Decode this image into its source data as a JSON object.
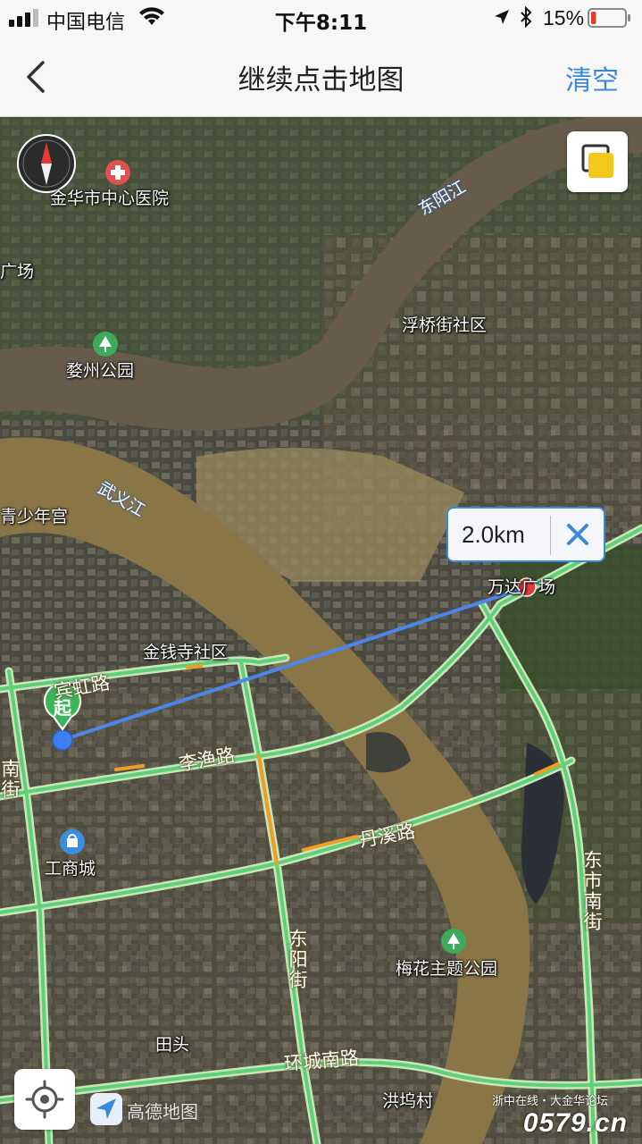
{
  "status_bar": {
    "carrier": "中国电信",
    "time": "下午8:11",
    "battery_percent": "15%",
    "battery_level": 0.15
  },
  "nav": {
    "title": "继续点击地图",
    "clear_label": "清空"
  },
  "map": {
    "distance": {
      "label": "2.0km"
    },
    "start_marker_label": "起",
    "pois": {
      "hospital": "金华市中心医院",
      "square_left": "广场",
      "fuqiao": "浮桥街社区",
      "lizhou_park": "婺州公园",
      "youth_palace": "青少年宫",
      "wanda": "万达广场",
      "jinqiansi": "金钱寺社区",
      "gongshang": "工商城",
      "meihua_park": "梅花主题公园",
      "tiantou": "田头",
      "hongwu": "洪坞村"
    },
    "rivers": {
      "dongyang_river": "东阳江",
      "wuyi_river": "武义江"
    },
    "roads": {
      "binhong": "宾虹路",
      "liyu": "李渔路",
      "nan_jie": "南街",
      "danxi": "丹溪路",
      "dongyang_street": "东阳街",
      "dongshi_south": "东市南街",
      "huancheng_south": "环城南路"
    },
    "logo": "高德地图",
    "watermark": {
      "line1": "浙中在线・大金华论坛",
      "line2": "0579.cn"
    },
    "icons": {
      "compass": "compass-icon",
      "layers": "layers-icon",
      "locate": "locate-icon",
      "close": "close-icon",
      "back": "back-chevron-icon"
    }
  }
}
